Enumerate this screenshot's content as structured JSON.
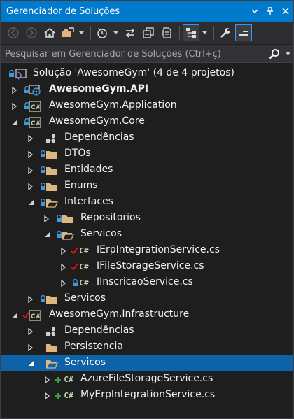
{
  "window": {
    "title": "Gerenciador de Soluções"
  },
  "toolbar": {
    "tools": [
      "back-icon",
      "forward-icon",
      "home-icon",
      "switch-views-icon",
      "history-icon",
      "sync-icon",
      "collapse-all-icon",
      "show-all-files-icon",
      "tree-view-icon",
      "properties-icon",
      "preview-icon"
    ]
  },
  "search": {
    "placeholder": "Pesquisar em Gerenciador de Soluções (Ctrl+ç)"
  },
  "tree": {
    "solution": "Solução 'AwesomeGym' (4 de 4 projetos)",
    "api": "AwesomeGym.API",
    "application": "AwesomeGym.Application",
    "core": "AwesomeGym.Core",
    "core_dependencias": "Dependências",
    "dtos": "DTOs",
    "entidades": "Entidades",
    "enums": "Enums",
    "interfaces": "Interfaces",
    "repositorios": "Repositorios",
    "interfaces_servicos": "Servicos",
    "ierp": "IErpIntegrationService.cs",
    "ifile": "IFileStorageService.cs",
    "iinscricao": "IInscricaoService.cs",
    "core_servicos": "Servicos",
    "infrastructure": "AwesomeGym.Infrastructure",
    "infra_dependencias": "Dependências",
    "persistencia": "Persistencia",
    "infra_servicos": "Servicos",
    "azure": "AzureFileStorageService.cs",
    "myerp": "MyErpIntegrationService.cs"
  },
  "colors": {
    "accent": "#007acc",
    "selection": "#0e62a8",
    "folder": "#dcb67a",
    "csharp": "#b8d7a3",
    "modified": "#e51400",
    "added": "#3c9d3c",
    "lock": "#3e9ae0"
  }
}
